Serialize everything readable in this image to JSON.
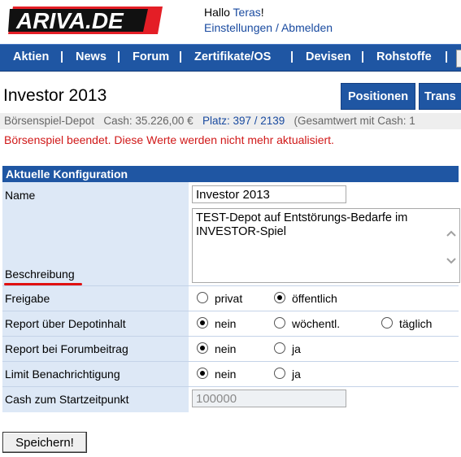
{
  "header": {
    "logo_text": "ARIVA.DE",
    "greeting_prefix": "Hallo ",
    "username": "Teras",
    "greeting_suffix": "!",
    "settings_link": "Einstellungen",
    "separator": " / ",
    "logout_link": "Abmelden"
  },
  "nav": {
    "items": [
      "Aktien",
      "News",
      "Forum",
      "Zertifikate/OS",
      "Devisen",
      "Rohstoffe"
    ],
    "separator": "|"
  },
  "page": {
    "title": "Investor 2013",
    "tabs": [
      "Positionen",
      "Trans"
    ]
  },
  "infobar": {
    "depot": "Börsenspiel-Depot",
    "cash": "Cash: 35.226,00 €",
    "platz": "Platz: 397 / 2139",
    "gesamtwert": "(Gesamtwert mit Cash: 1"
  },
  "warning": "Börsenspiel beendet. Diese Werte werden nicht mehr aktualisiert.",
  "config": {
    "heading": "Aktuelle Konfiguration",
    "name_label": "Name",
    "name_value": "Investor 2013",
    "beschreibung_label": "Beschreibung",
    "beschreibung_value": "TEST-Depot auf Entstörungs-Bedarfe im INVESTOR-Spiel",
    "freigabe_label": "Freigabe",
    "freigabe_options": [
      "privat",
      "öffentlich"
    ],
    "freigabe_selected": "öffentlich",
    "report_depot_label": "Report über Depotinhalt",
    "report_depot_options": [
      "nein",
      "wöchentl.",
      "täglich"
    ],
    "report_depot_selected": "nein",
    "report_forum_label": "Report bei Forumbeitrag",
    "report_forum_options": [
      "nein",
      "ja"
    ],
    "report_forum_selected": "nein",
    "limit_label": "Limit Benachrichtigung",
    "limit_options": [
      "nein",
      "ja"
    ],
    "limit_selected": "nein",
    "cash_label": "Cash zum Startzeitpunkt",
    "cash_value": "100000"
  },
  "save_button": "Speichern!",
  "colors": {
    "nav_blue": "#1f56a3",
    "label_bg": "#dde8f6",
    "warning_red": "#d01818",
    "link_blue": "#1a4ba0"
  }
}
